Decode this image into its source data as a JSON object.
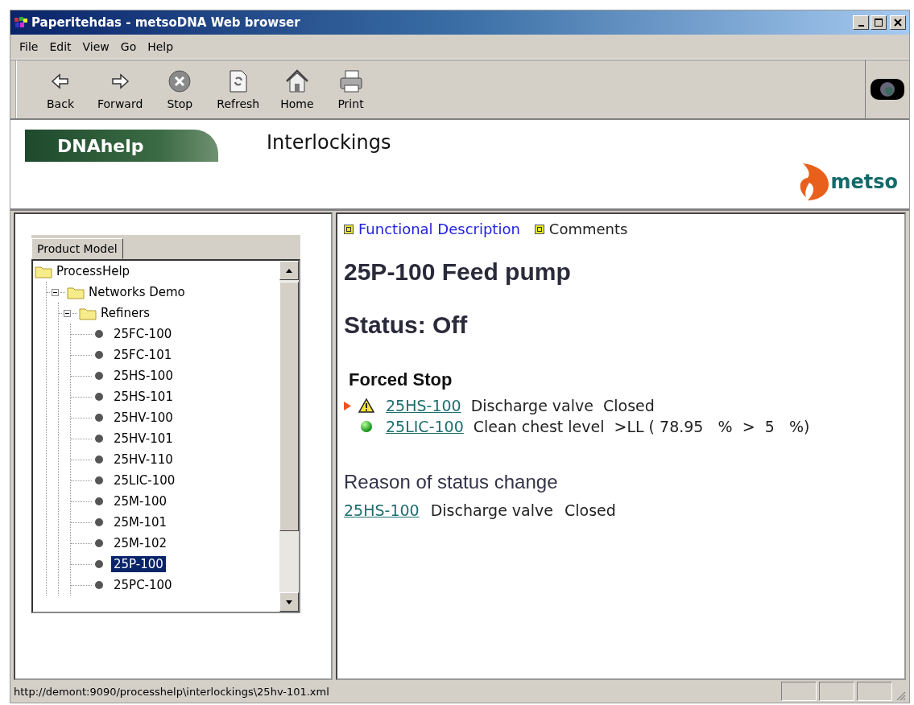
{
  "window": {
    "title": "Paperitehdas - metsoDNA Web browser"
  },
  "menu": [
    "File",
    "Edit",
    "View",
    "Go",
    "Help"
  ],
  "toolbar": [
    {
      "label": "Back",
      "kind": "back"
    },
    {
      "label": "Forward",
      "kind": "forward"
    },
    {
      "label": "Stop",
      "kind": "stop"
    },
    {
      "label": "Refresh",
      "kind": "refresh"
    },
    {
      "label": "Home",
      "kind": "home"
    },
    {
      "label": "Print",
      "kind": "print"
    }
  ],
  "banner": {
    "product": "DNAhelp",
    "page_title": "Interlockings",
    "logo": "metso"
  },
  "sidebar": {
    "tab": "Product Model",
    "tree": [
      {
        "label": "ProcessHelp",
        "kind": "folder",
        "selected": false,
        "children": [
          {
            "label": "Networks Demo",
            "kind": "folder",
            "expanded": true,
            "selected": false,
            "children": [
              {
                "label": "Refiners",
                "kind": "folder",
                "expanded": true,
                "selected": false,
                "children": [
                  {
                    "label": "25FC-100",
                    "kind": "leaf",
                    "selected": false
                  },
                  {
                    "label": "25FC-101",
                    "kind": "leaf",
                    "selected": false
                  },
                  {
                    "label": "25HS-100",
                    "kind": "leaf",
                    "selected": false
                  },
                  {
                    "label": "25HS-101",
                    "kind": "leaf",
                    "selected": false
                  },
                  {
                    "label": "25HV-100",
                    "kind": "leaf",
                    "selected": false
                  },
                  {
                    "label": "25HV-101",
                    "kind": "leaf",
                    "selected": false
                  },
                  {
                    "label": "25HV-110",
                    "kind": "leaf",
                    "selected": false
                  },
                  {
                    "label": "25LIC-100",
                    "kind": "leaf",
                    "selected": false
                  },
                  {
                    "label": "25M-100",
                    "kind": "leaf",
                    "selected": false
                  },
                  {
                    "label": "25M-101",
                    "kind": "leaf",
                    "selected": false
                  },
                  {
                    "label": "25M-102",
                    "kind": "leaf",
                    "selected": false
                  },
                  {
                    "label": "25P-100",
                    "kind": "leaf",
                    "selected": true
                  },
                  {
                    "label": "25PC-100",
                    "kind": "leaf",
                    "selected": false
                  }
                ]
              }
            ]
          }
        ]
      }
    ]
  },
  "content": {
    "links": [
      {
        "label": "Functional Description",
        "kind": "link"
      },
      {
        "label": "Comments",
        "kind": "text"
      }
    ],
    "heading": "25P-100 Feed pump",
    "status": "Status: Off",
    "forced_stop": {
      "title": "Forced Stop",
      "rows": [
        {
          "marked": true,
          "kind": "warning",
          "tag": "25HS-100",
          "description": "Discharge valve",
          "state": "Closed"
        },
        {
          "marked": false,
          "kind": "ok",
          "tag": "25LIC-100",
          "description": "Clean chest level",
          "state": ">LL ( 78.95   %  >  5   %)"
        }
      ]
    },
    "reason": {
      "title": "Reason of status change",
      "tag": "25HS-100",
      "description": "Discharge valve",
      "state": "Closed"
    }
  },
  "status_bar": "http://demont:9090/processhelp\\interlockings\\25hv-101.xml"
}
